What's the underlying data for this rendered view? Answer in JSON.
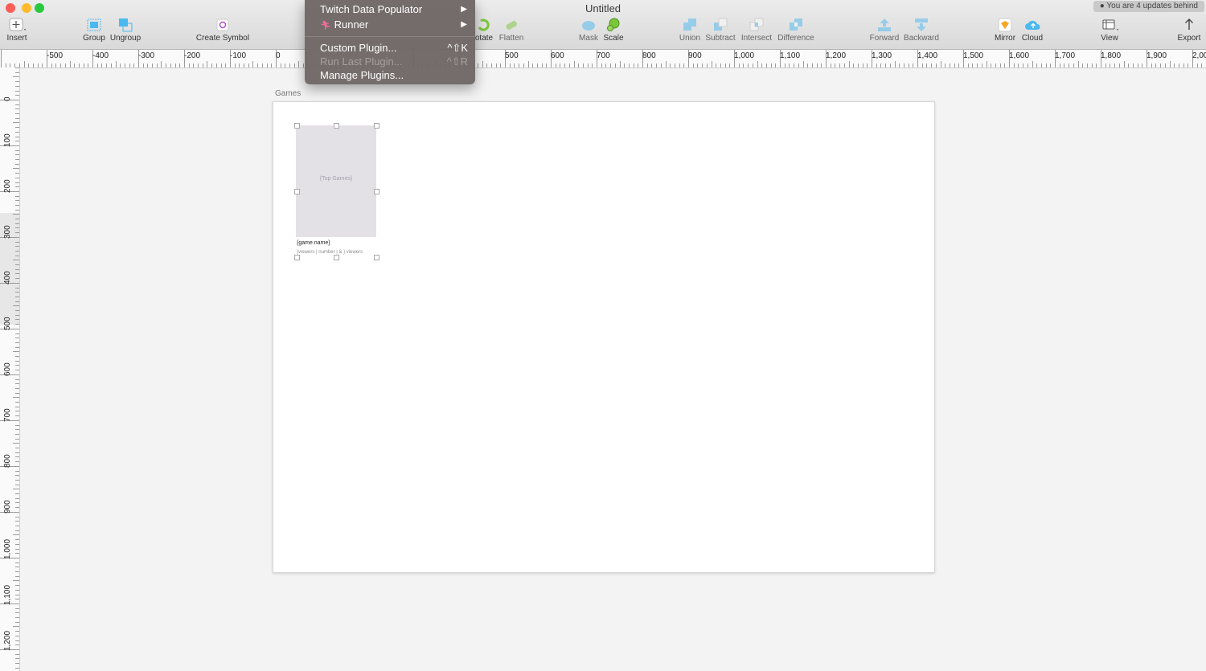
{
  "window": {
    "title": "Untitled",
    "update_notice": "You are 4 updates behind"
  },
  "toolbar": {
    "insert": "Insert",
    "group": "Group",
    "ungroup": "Ungroup",
    "create_symbol": "Create Symbol",
    "rotate": "otate",
    "flatten": "Flatten",
    "mask": "Mask",
    "scale": "Scale",
    "union": "Union",
    "subtract": "Subtract",
    "intersect": "Intersect",
    "difference": "Difference",
    "forward": "Forward",
    "backward": "Backward",
    "mirror": "Mirror",
    "cloud": "Cloud",
    "view": "View",
    "export": "Export"
  },
  "rulers": {
    "horizontal": [
      "-500",
      "-400",
      "-300",
      "-200",
      "-100",
      "0",
      "500",
      "600",
      "700",
      "800",
      "900",
      "1,000",
      "1,100",
      "1,200",
      "1,300",
      "1,400",
      "1,500",
      "1,600",
      "1,700",
      "1,800",
      "1,900",
      "2,00"
    ],
    "vertical": [
      "0",
      "100",
      "200",
      "300",
      "400",
      "500",
      "600",
      "700",
      "800",
      "900",
      "1,000",
      "1,100",
      "1,200"
    ]
  },
  "artboard": {
    "title": "Games"
  },
  "card": {
    "image_placeholder": "{Top Games}",
    "name": "{game.name}",
    "viewers": "{viewers | number | & } viewers"
  },
  "menu": {
    "twitch": "Twitch Data Populator",
    "runner": "Runner",
    "custom": "Custom Plugin...",
    "custom_shortcut": "^⇧K",
    "run_last": "Run Last Plugin...",
    "run_last_shortcut": "^⇧R",
    "manage": "Manage Plugins..."
  },
  "colors": {
    "accent": "#4cb8f0",
    "menu_bg": "#6e6765",
    "scale_green": "#7cc63a"
  }
}
